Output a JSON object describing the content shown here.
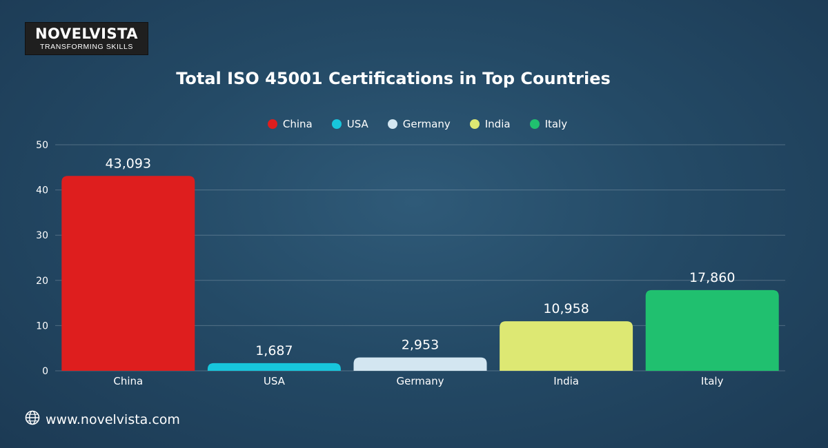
{
  "logo": {
    "name": "NOVELVISTA",
    "tagline": "TRANSFORMING SKILLS"
  },
  "footer": {
    "website": "www.novelvista.com",
    "icon": "globe-icon"
  },
  "chart_data": {
    "type": "bar",
    "title": "Total ISO 45001 Certifications in Top Countries",
    "categories": [
      "China",
      "USA",
      "Germany",
      "India",
      "Italy"
    ],
    "values": [
      43.093,
      1.687,
      2.953,
      10.958,
      17.86
    ],
    "data_labels": [
      "43,093",
      "1,687",
      "2,953",
      "10,958",
      "17,860"
    ],
    "colors": [
      "#de1e1e",
      "#17c6dc",
      "#d3e6f1",
      "#dde873",
      "#20c06f"
    ],
    "ylim": [
      0,
      50
    ],
    "yticks": [
      0,
      10,
      20,
      30,
      40,
      50
    ],
    "grid": true,
    "legend_position": "top"
  }
}
